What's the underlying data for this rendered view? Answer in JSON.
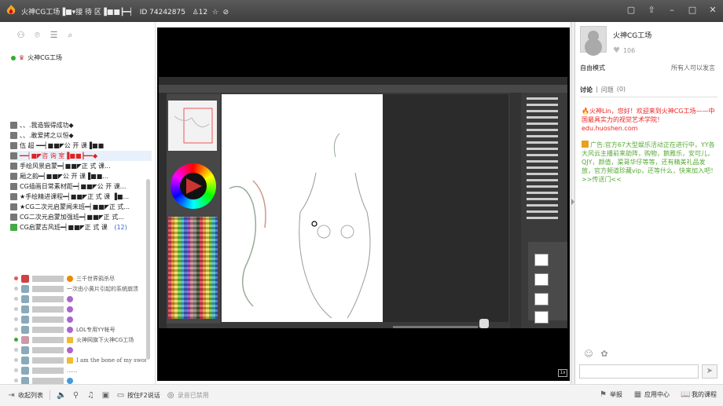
{
  "window": {
    "title": "火神CG工场▐■▾接 待 区▐■■┣━┥",
    "room_id": "ID 74242875",
    "online_count": "12"
  },
  "left": {
    "room_name": "火神CG工场",
    "channels": [
      {
        "label": "、、.我造锻得成功◆"
      },
      {
        "label": "、、.敢爱拷之以恒◆"
      },
      {
        "label": "伍 超 ━━┥■■◤公  开  课▐■■"
      },
      {
        "label": "━━┥■◤咨  询  室▐■■┣━━◆"
      },
      {
        "label": "手绘风景启蒙━┥■■◤正  式  课..."
      },
      {
        "label": "厢之韵━┥■■◤公  开  课▐■■..."
      },
      {
        "label": "CG插画日常素材距━┥■■◤公  开  课..."
      },
      {
        "label": "★手绘精进课程━┥■■◤正 式  课 ▐■..."
      },
      {
        "label": "★CG二次元启蒙闻未班━┥■■◤正  式..."
      },
      {
        "label": "CG二次元启蒙加强班━┥■■◤正  式..."
      },
      {
        "label": "CG启蒙古风班━┥■■◤正  式  课",
        "count": "(12)"
      }
    ],
    "members": [
      {
        "text": "三千世界鸦杀尽"
      },
      {
        "text": "一次由小黄片引起的系统崩溃"
      },
      {
        "text": ""
      },
      {
        "text": ""
      },
      {
        "text": ""
      },
      {
        "text": "LOL专用YY帐号"
      },
      {
        "text": "火神网旗下火神CG工场"
      },
      {
        "text": ""
      },
      {
        "text": "I am the bone of my sword"
      },
      {
        "text": "......"
      },
      {
        "text": ""
      }
    ]
  },
  "video": {
    "badge": "1x"
  },
  "right": {
    "host_name": "火神CG工场",
    "likes": "106",
    "mode": "自由模式",
    "mode_desc": "所有人可以发言",
    "tab_discuss": "讨论",
    "tab_separator": "|",
    "tab_questions": "问题",
    "question_count": "(0)",
    "msg1": "火神Lin，您好！欢迎来到火神CG工场——中国最具实力的视觉艺术学院！edu.huoshen.com",
    "msg2": "广告:官方67大型娱乐活动正在进行中，YY各大风云主播前来助阵，购物，鹅雅乐，安可儿，QJY，颜值，渠哥华仔等等，还有精美礼品发放，官方频道珍藏vip，还等什么，快来加入吧！>>传送门<<"
  },
  "bottom": {
    "channel_list": "收起列表",
    "hold_f2": "按住F2说话",
    "recording": "录音已禁用",
    "report": "举报",
    "app_center": "应用中心",
    "my_courses": "我的课程"
  },
  "colors": {
    "titlebar": "#4a4a4a",
    "accent_red": "#e22222",
    "ad_green": "#55aa33"
  }
}
